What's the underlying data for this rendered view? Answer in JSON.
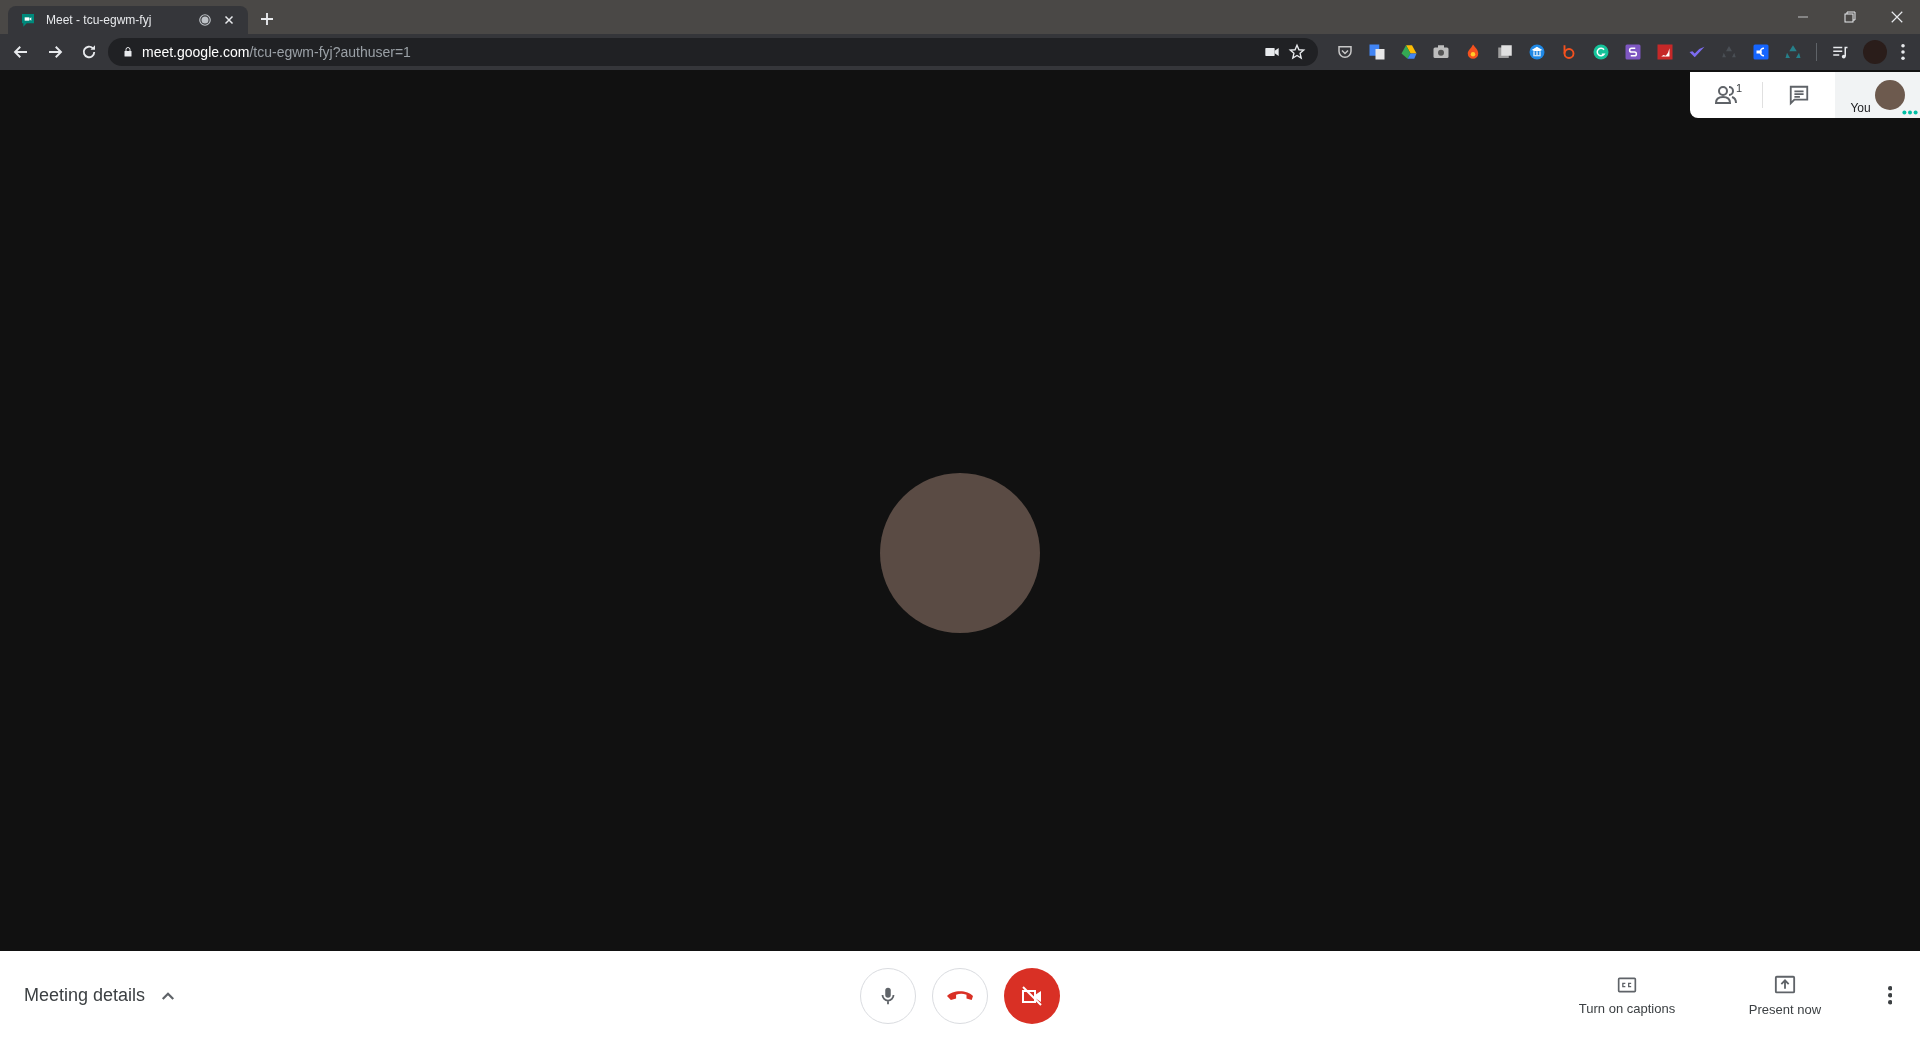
{
  "browser": {
    "tab": {
      "title": "Meet - tcu-egwm-fyj",
      "selected": true
    },
    "url": {
      "host": "meet.google.com",
      "path": "/tcu-egwm-fyj?authuser=1"
    }
  },
  "meet": {
    "participants_count": "1",
    "self_label": "You",
    "mic_muted": false,
    "camera_off": true
  },
  "bottom_bar": {
    "meeting_details": "Meeting details",
    "actions": [
      {
        "kind": "captions",
        "label": "Turn on captions"
      },
      {
        "kind": "present",
        "label": "Present now"
      }
    ]
  }
}
